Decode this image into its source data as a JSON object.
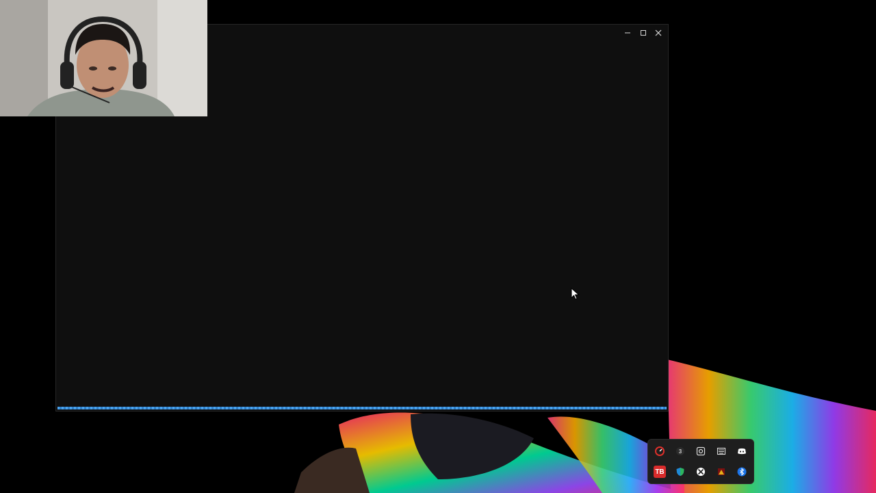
{
  "window": {
    "title": "",
    "controls": [
      "minimize",
      "maximize",
      "close"
    ],
    "progress_fraction": 1.0
  },
  "webcam": {
    "description_icon": "webcam-feed"
  },
  "tray": {
    "icons": [
      {
        "name": "clock-app-icon",
        "color": "#e0302b"
      },
      {
        "name": "number-app-icon",
        "color": "#444444"
      },
      {
        "name": "capture-app-icon",
        "color": "#5a5a5a"
      },
      {
        "name": "keyboard-app-icon",
        "color": "#5a5a5a"
      },
      {
        "name": "discord-icon",
        "color": "#5865f2"
      },
      {
        "name": "tb-app-icon",
        "color": "#d92b2b",
        "label": "TB"
      },
      {
        "name": "defender-shield-icon",
        "color": "#1f8ad6"
      },
      {
        "name": "xbox-icon",
        "color": "#ffffff"
      },
      {
        "name": "warning-app-icon",
        "color": "#e3b219"
      },
      {
        "name": "bluetooth-icon",
        "color": "#1a73e8"
      }
    ]
  },
  "colors": {
    "accent": "#3d8fd9",
    "window_bg": "#0f0f0f"
  }
}
